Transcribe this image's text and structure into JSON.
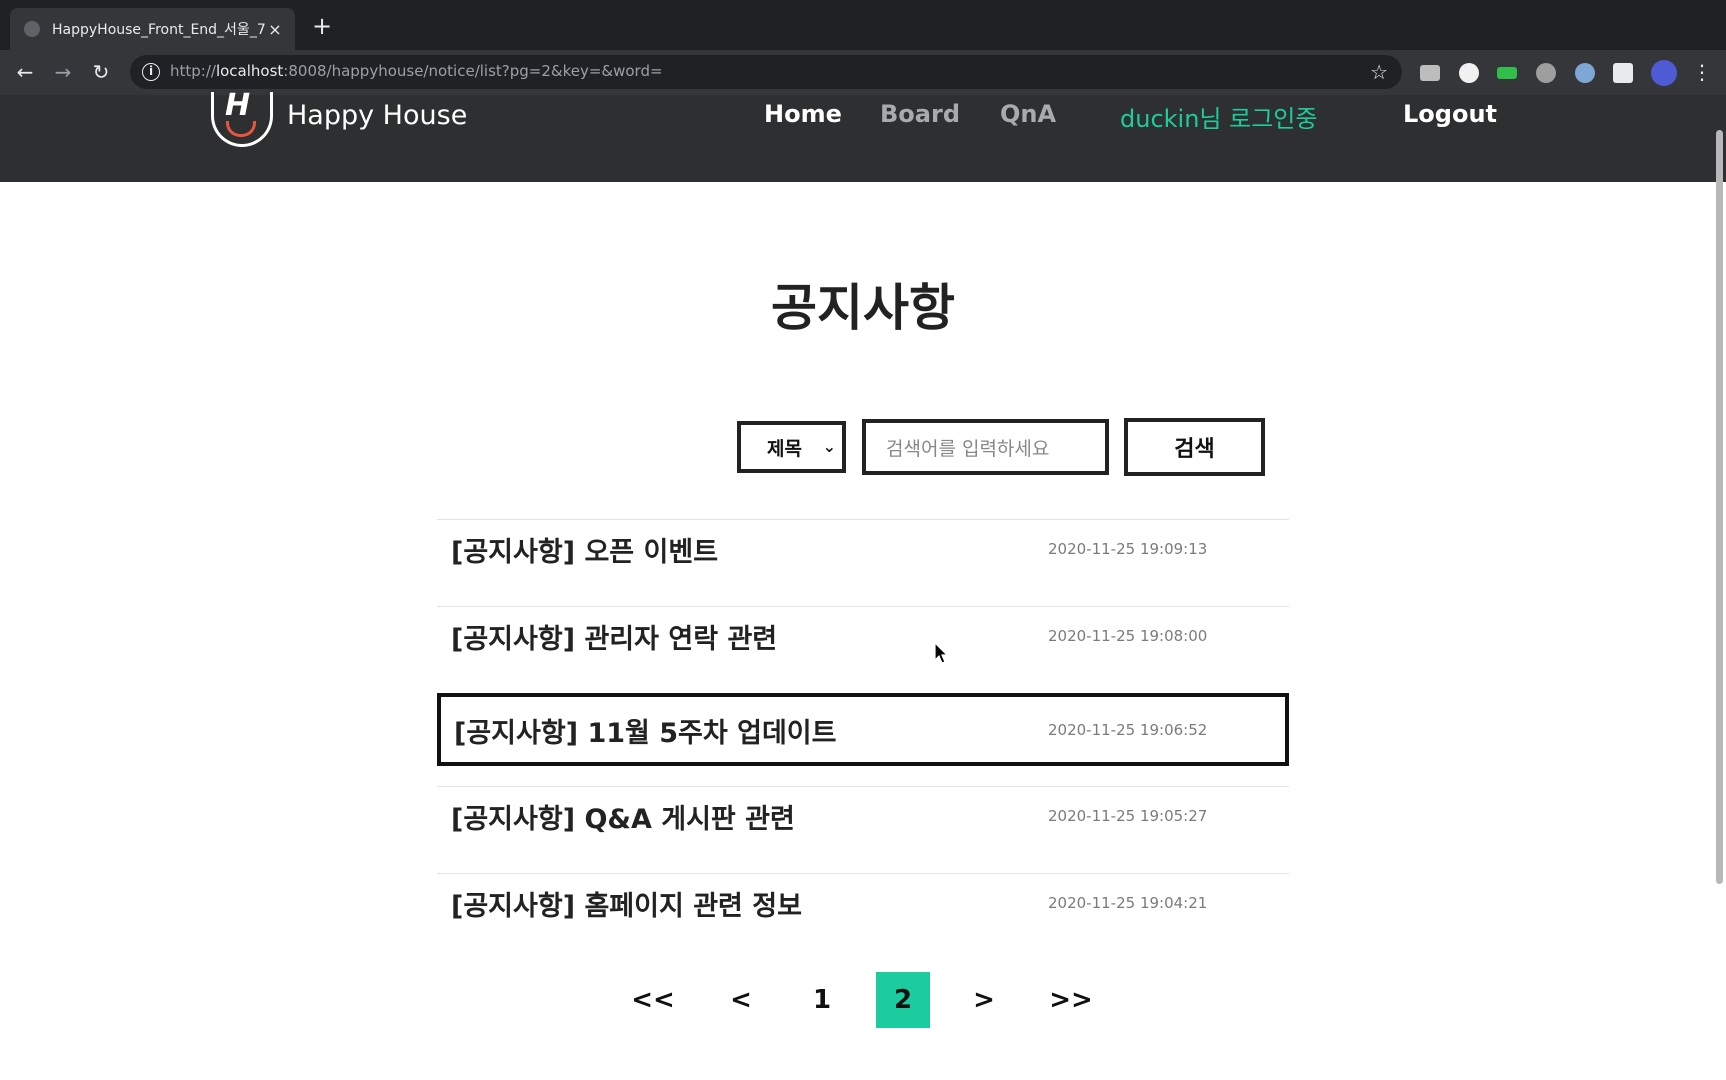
{
  "browser": {
    "tab_title": "HappyHouse_Front_End_서울_7",
    "tab_close": "×",
    "new_tab": "+",
    "url_prefix": "http://",
    "url_host": "localhost",
    "url_rest": ":8008/happyhouse/notice/list?pg=2&key=&word=",
    "back": "←",
    "forward": "→",
    "reload": "↻",
    "info": "i",
    "bookmark": "☆",
    "menu": "⋮"
  },
  "header": {
    "brand": "Happy House",
    "logo_letter": "H",
    "nav": {
      "home": "Home",
      "board": "Board",
      "qna": "QnA",
      "user_status": "duckin님 로그인중",
      "logout": "Logout"
    }
  },
  "page": {
    "title": "공지사항"
  },
  "search": {
    "selected_option": "제목",
    "placeholder": "검색어를 입력하세요",
    "button_label": "검색",
    "chevron": "⌄"
  },
  "notices": [
    {
      "title": "[공지사항] 오픈 이벤트",
      "date": "2020-11-25 19:09:13"
    },
    {
      "title": "[공지사항] 관리자 연락 관련",
      "date": "2020-11-25 19:08:00"
    },
    {
      "title": "[공지사항] 11월 5주차 업데이트",
      "date": "2020-11-25 19:06:52"
    },
    {
      "title": "[공지사항] Q&A 게시판 관련",
      "date": "2020-11-25 19:05:27"
    },
    {
      "title": "[공지사항] 홈페이지 관련 정보",
      "date": "2020-11-25 19:04:21"
    }
  ],
  "pagination": {
    "first": "<<",
    "prev": "<",
    "pages": [
      "1",
      "2"
    ],
    "current": "2",
    "next": ">",
    "last": ">>"
  },
  "colors": {
    "accent": "#1ccc9e",
    "header_bg": "#2e2f31",
    "logo_mouth": "#e8553f"
  }
}
